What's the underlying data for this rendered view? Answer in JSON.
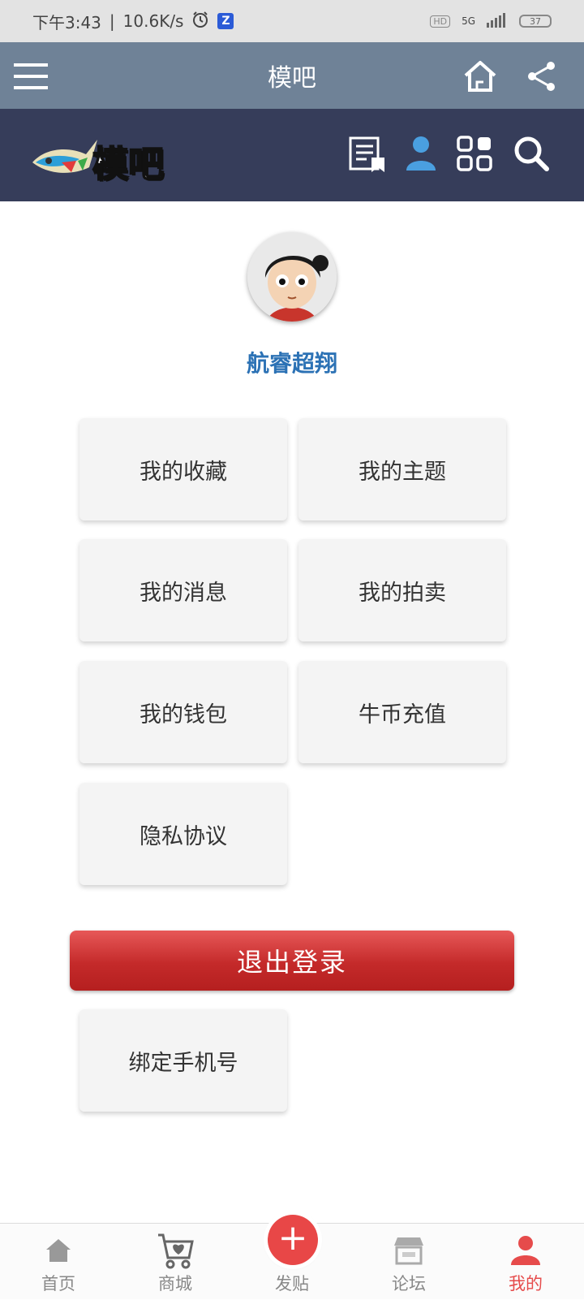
{
  "status_bar": {
    "time": "下午3:43",
    "separator": "|",
    "speed": "10.6K/s",
    "alarm_icon": "alarm-icon",
    "hd": "HD",
    "network": "5G",
    "battery": "37"
  },
  "header": {
    "title": "模吧",
    "menu_icon": "hamburger-icon",
    "home_icon": "home-icon",
    "share_icon": "share-icon"
  },
  "site_nav": {
    "logo_text": "模吧",
    "icons": [
      "notes-icon",
      "user-icon",
      "grid-icon",
      "search-icon"
    ]
  },
  "profile": {
    "username": "航睿超翔"
  },
  "menu": {
    "favorites": "我的收藏",
    "topics": "我的主题",
    "messages": "我的消息",
    "auctions": "我的拍卖",
    "wallet": "我的钱包",
    "recharge": "牛币充值",
    "privacy": "隐私协议",
    "logout": "退出登录",
    "bind_phone": "绑定手机号"
  },
  "bottom_tabs": {
    "home": "首页",
    "mall": "商城",
    "post": "发贴",
    "post_symbol": "+",
    "forum": "论坛",
    "mine": "我的"
  },
  "colors": {
    "header_bg": "#6f8297",
    "nav_bg": "#363d5a",
    "username": "#2c72b5",
    "logout": "#c42a2a",
    "accent": "#e64b4b"
  }
}
